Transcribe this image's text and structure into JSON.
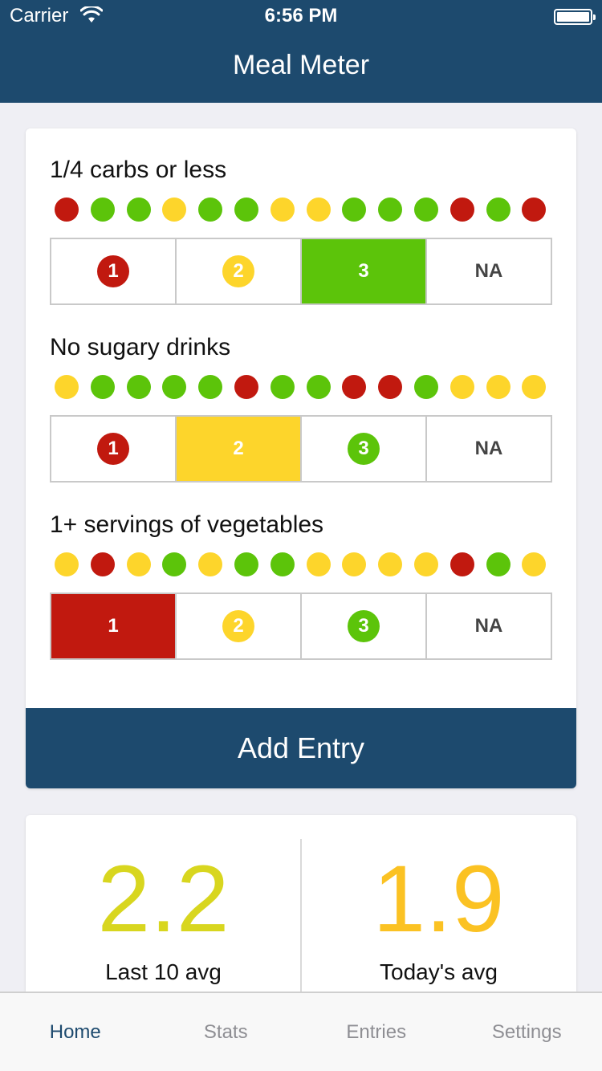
{
  "status_bar": {
    "carrier": "Carrier",
    "time": "6:56 PM"
  },
  "nav": {
    "title": "Meal Meter"
  },
  "colors": {
    "red": "#c1190f",
    "green": "#5cc40a",
    "yellow": "#fdd52b",
    "navy": "#1d4a6e",
    "stat1": "#d8d61f",
    "stat2": "#fbc223"
  },
  "questions": [
    {
      "title": "1/4 carbs or less",
      "history": [
        "red",
        "green",
        "green",
        "yellow",
        "green",
        "green",
        "yellow",
        "yellow",
        "green",
        "green",
        "green",
        "red",
        "green",
        "red"
      ],
      "options": [
        "1",
        "2",
        "3",
        "NA"
      ],
      "selected": 2
    },
    {
      "title": "No sugary drinks",
      "history": [
        "yellow",
        "green",
        "green",
        "green",
        "green",
        "red",
        "green",
        "green",
        "red",
        "red",
        "green",
        "yellow",
        "yellow",
        "yellow"
      ],
      "options": [
        "1",
        "2",
        "3",
        "NA"
      ],
      "selected": 1
    },
    {
      "title": "1+ servings of vegetables",
      "history": [
        "yellow",
        "red",
        "yellow",
        "green",
        "yellow",
        "green",
        "green",
        "yellow",
        "yellow",
        "yellow",
        "yellow",
        "red",
        "green",
        "yellow"
      ],
      "options": [
        "1",
        "2",
        "3",
        "NA"
      ],
      "selected": 0
    }
  ],
  "add_entry": {
    "label": "Add Entry"
  },
  "stats": [
    {
      "value": "2.2",
      "label": "Last 10 avg",
      "color": "stat1"
    },
    {
      "value": "1.9",
      "label": "Today's avg",
      "color": "stat2"
    }
  ],
  "tabs": [
    {
      "label": "Home",
      "active": true
    },
    {
      "label": "Stats",
      "active": false
    },
    {
      "label": "Entries",
      "active": false
    },
    {
      "label": "Settings",
      "active": false
    }
  ]
}
